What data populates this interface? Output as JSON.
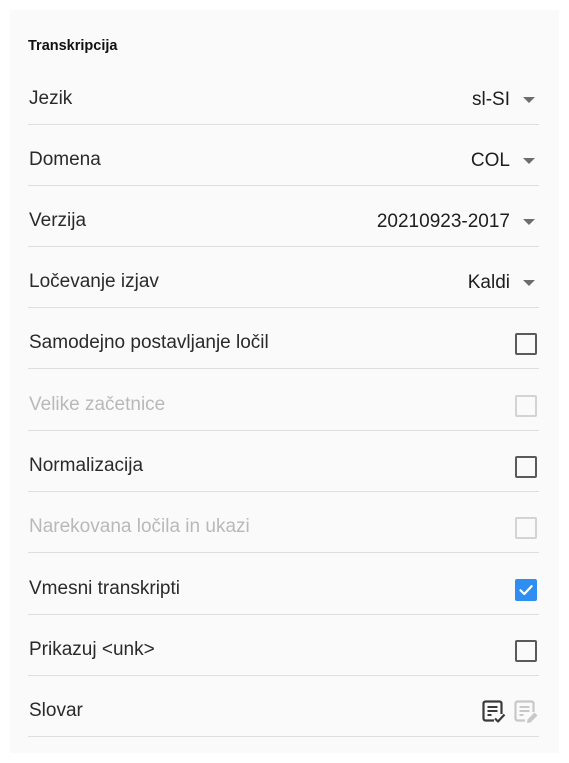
{
  "section_title": "Transkripcija",
  "rows": {
    "jezik": {
      "label": "Jezik",
      "value": "sl-SI"
    },
    "domena": {
      "label": "Domena",
      "value": "COL"
    },
    "verzija": {
      "label": "Verzija",
      "value": "20210923-2017"
    },
    "locevanje": {
      "label": "Ločevanje izjav",
      "value": "Kaldi"
    },
    "samodejno": {
      "label": "Samodejno postavljanje ločil",
      "checked": false,
      "disabled": false
    },
    "velike": {
      "label": "Velike začetnice",
      "checked": false,
      "disabled": true
    },
    "normalizacija": {
      "label": "Normalizacija",
      "checked": false,
      "disabled": false
    },
    "narekovana": {
      "label": "Narekovana ločila in ukazi",
      "checked": false,
      "disabled": true
    },
    "vmesni": {
      "label": "Vmesni transkripti",
      "checked": true,
      "disabled": false
    },
    "prikazuj": {
      "label": "Prikazuj <unk>",
      "checked": false,
      "disabled": false
    },
    "slovar": {
      "label": "Slovar",
      "icons": [
        "dictionary-review-icon",
        "dictionary-edit-icon"
      ]
    }
  },
  "colors": {
    "accent": "#2f8ff0",
    "text": "#2a2a2a",
    "disabled_text": "#b9b9b9",
    "divider": "#dedede",
    "panel_bg": "#fafafa"
  }
}
